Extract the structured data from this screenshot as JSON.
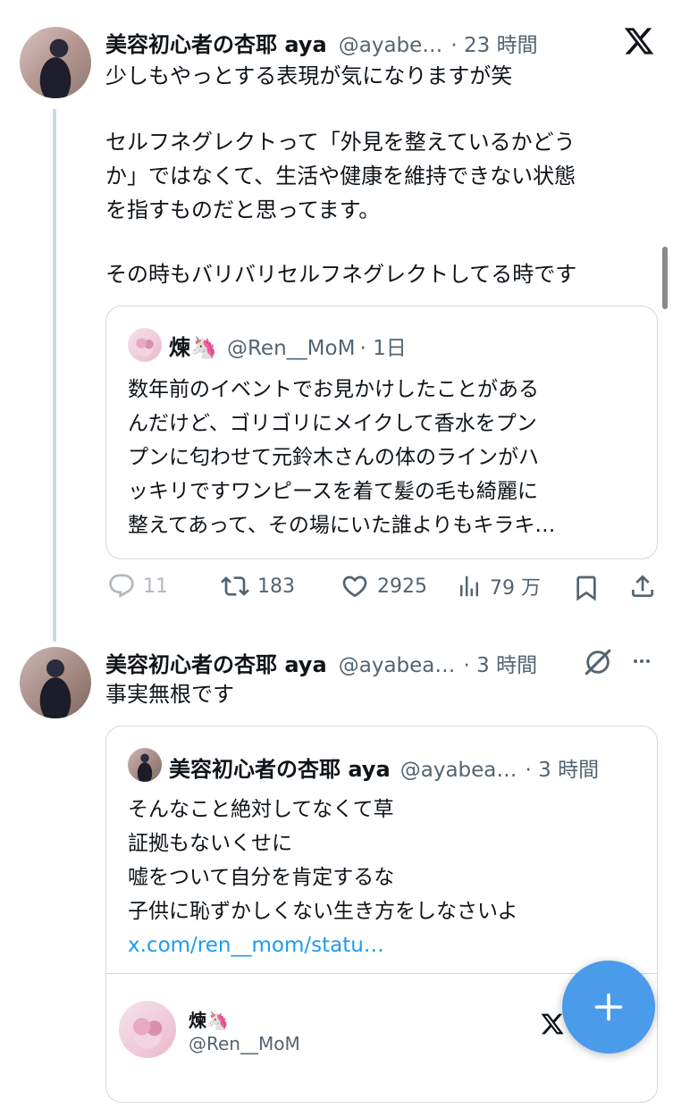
{
  "tweet1": {
    "display_name": "美容初心者の杏耶 aya",
    "handle": "@ayabe…",
    "time": "· 23 時間",
    "lines": [
      "少しもやっとする表現が気になりますが笑",
      "",
      "セルフネグレクトって「外見を整えているかどう",
      "か」ではなくて、生活や健康を維持できない状態",
      "を指すものだと思ってます。",
      "",
      "その時もバリバリセルフネグレクトしてる時です"
    ],
    "quote": {
      "display_name": "煉🦄",
      "handle": "@Ren__MoM",
      "time": "· 1日",
      "lines": [
        "数年前のイベントでお見かけしたことがある",
        "んだけど、ゴリゴリにメイクして香水をプン",
        "プンに匂わせて元鈴木さんの体のラインがハ",
        "ッキリですワンピースを着て髪の毛も綺麗に",
        "整えてあって、その場にいた誰よりもキラキ…"
      ]
    },
    "actions": {
      "replies": "11",
      "retweets": "183",
      "likes": "2925",
      "views": "79 万"
    }
  },
  "tweet2": {
    "display_name": "美容初心者の杏耶 aya",
    "handle": "@ayabea…",
    "time": "· 3 時間",
    "text": "事実無根です",
    "quote": {
      "display_name": "美容初心者の杏耶 aya",
      "handle": "@ayabea…",
      "time": "· 3 時間",
      "lines": [
        "そんなこと絶対してなくて草",
        "証拠もないくせに",
        "嘘をついて自分を肯定するな",
        "子供に恥ずかしくない生き方をしなさいよ"
      ],
      "link": "x.com/ren__mom/statu…",
      "embed": {
        "display_name": "煉🦄",
        "handle": "@Ren__MoM"
      }
    }
  },
  "colors": {
    "text": "#0f1419",
    "secondary": "#536471",
    "border": "#cfd9de",
    "link": "#1d9bf0",
    "fab": "#4a9bea"
  },
  "icons": [
    "x-logo-icon",
    "reply-icon",
    "retweet-icon",
    "like-icon",
    "views-icon",
    "bookmark-icon",
    "share-icon",
    "grok-icon",
    "more-icon",
    "plus-icon"
  ]
}
